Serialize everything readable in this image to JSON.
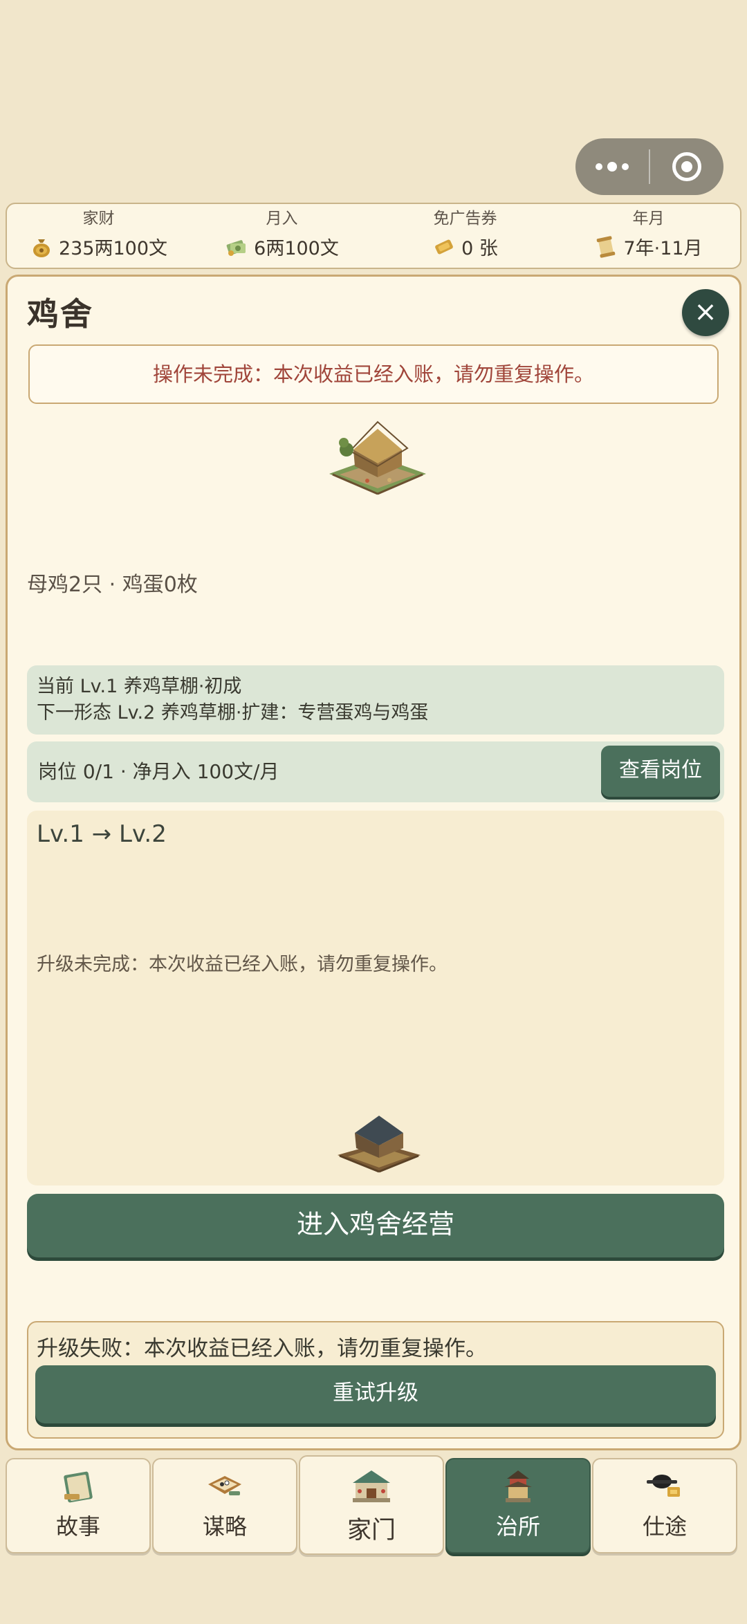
{
  "stats": [
    {
      "label": "家财",
      "value": "235两100文",
      "icon": "money-bag-icon"
    },
    {
      "label": "月入",
      "value": "6两100文",
      "icon": "banknote-icon"
    },
    {
      "label": "免广告券",
      "value": "0 张",
      "icon": "coupon-icon"
    },
    {
      "label": "年月",
      "value": "7年·11月",
      "icon": "scroll-icon"
    }
  ],
  "panel": {
    "title": "鸡舍",
    "close_label": "×",
    "warning": "操作未完成：本次收益已经入账，请勿重复操作。",
    "hens": "母鸡2只 · 鸡蛋0枚",
    "current_form": "当前 Lv.1 养鸡草棚·初成",
    "next_form": "下一形态 Lv.2 养鸡草棚·扩建：专营蛋鸡与鸡蛋",
    "post_info": "岗位 0/1 · 净月入 100文/月",
    "view_post_label": "查看岗位",
    "upgrade_levels": "Lv.1 → Lv.2",
    "upgrade_message": "升级未完成：本次收益已经入账，请勿重复操作。",
    "enter_label": "进入鸡舍经营",
    "fail_message": "升级失败：本次收益已经入账，请勿重复操作。",
    "retry_label": "重试升级"
  },
  "tabs": [
    {
      "label": "故事",
      "icon": "book-icon"
    },
    {
      "label": "谋略",
      "icon": "strategy-scroll-icon"
    },
    {
      "label": "家门",
      "icon": "house-icon"
    },
    {
      "label": "治所",
      "icon": "pavilion-icon"
    },
    {
      "label": "仕途",
      "icon": "official-hat-icon"
    }
  ]
}
